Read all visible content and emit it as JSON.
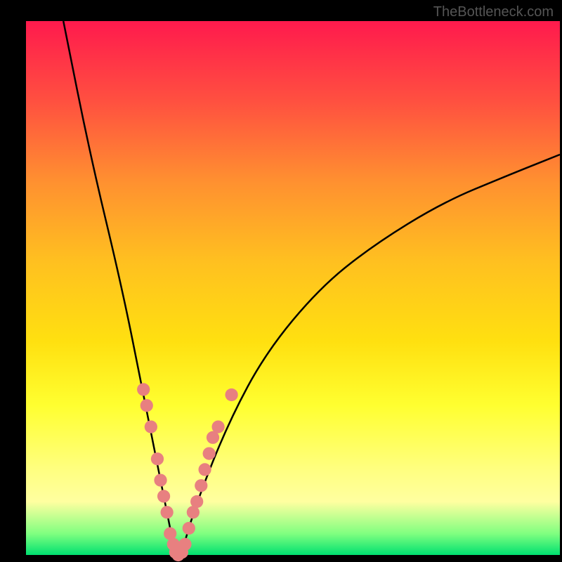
{
  "watermark": "TheBottleneck.com",
  "chart_data": {
    "type": "line",
    "title": "",
    "xlabel": "",
    "ylabel": "",
    "xlim": [
      0,
      100
    ],
    "ylim": [
      0,
      100
    ],
    "curve_left": {
      "description": "left descending branch of V-shaped bottleneck curve",
      "points": [
        {
          "x": 7,
          "y": 100
        },
        {
          "x": 12,
          "y": 75
        },
        {
          "x": 18,
          "y": 50
        },
        {
          "x": 22,
          "y": 30
        },
        {
          "x": 25,
          "y": 15
        },
        {
          "x": 27,
          "y": 5
        },
        {
          "x": 28,
          "y": 0
        }
      ]
    },
    "curve_right": {
      "description": "right ascending branch, concave",
      "points": [
        {
          "x": 29,
          "y": 0
        },
        {
          "x": 32,
          "y": 10
        },
        {
          "x": 38,
          "y": 25
        },
        {
          "x": 45,
          "y": 38
        },
        {
          "x": 55,
          "y": 50
        },
        {
          "x": 65,
          "y": 58
        },
        {
          "x": 78,
          "y": 66
        },
        {
          "x": 90,
          "y": 71
        },
        {
          "x": 100,
          "y": 75
        }
      ]
    },
    "markers_left": [
      {
        "x": 22.0,
        "y": 31
      },
      {
        "x": 22.6,
        "y": 28
      },
      {
        "x": 23.4,
        "y": 24
      },
      {
        "x": 24.6,
        "y": 18
      },
      {
        "x": 25.2,
        "y": 14
      },
      {
        "x": 25.8,
        "y": 11
      },
      {
        "x": 26.4,
        "y": 8
      },
      {
        "x": 27.0,
        "y": 4
      },
      {
        "x": 27.6,
        "y": 2
      },
      {
        "x": 28.0,
        "y": 0.5
      },
      {
        "x": 28.5,
        "y": 0
      }
    ],
    "markers_right": [
      {
        "x": 29.2,
        "y": 0.5
      },
      {
        "x": 29.8,
        "y": 2
      },
      {
        "x": 30.5,
        "y": 5
      },
      {
        "x": 31.3,
        "y": 8
      },
      {
        "x": 32.0,
        "y": 10
      },
      {
        "x": 32.8,
        "y": 13
      },
      {
        "x": 33.5,
        "y": 16
      },
      {
        "x": 34.3,
        "y": 19
      },
      {
        "x": 35.0,
        "y": 22
      },
      {
        "x": 36.0,
        "y": 24
      },
      {
        "x": 38.5,
        "y": 30
      }
    ],
    "marker_color": "#e88080",
    "marker_radius_pct": 1.2
  }
}
